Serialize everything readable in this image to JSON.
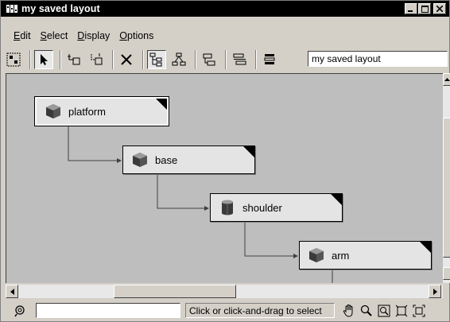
{
  "window": {
    "title": "my saved layout"
  },
  "menubar": {
    "items": [
      {
        "label": "Edit",
        "mnemonic": "E",
        "rest": "dit"
      },
      {
        "label": "Select",
        "mnemonic": "S",
        "rest": "elect"
      },
      {
        "label": "Display",
        "mnemonic": "D",
        "rest": "isplay"
      },
      {
        "label": "Options",
        "mnemonic": "O",
        "rest": "ptions"
      }
    ]
  },
  "toolbar": {
    "layout_name": "my saved layout",
    "icons": [
      "layout-icon",
      "select-arrow-icon",
      "parent-icon",
      "unparent-icon",
      "delete-icon",
      "hierarchy-icon",
      "tree-icon",
      "graph-icon",
      "align-icon",
      "list-icon"
    ]
  },
  "nodes": [
    {
      "label": "platform",
      "icon": "cube-icon"
    },
    {
      "label": "base",
      "icon": "cube-icon"
    },
    {
      "label": "shoulder",
      "icon": "cylinder-icon"
    },
    {
      "label": "arm",
      "icon": "cube-icon"
    }
  ],
  "statusbar": {
    "input_value": "",
    "message": "Click or click-and-drag to select",
    "icons": [
      "pan-hand-icon",
      "zoom-icon",
      "zoom-region-icon",
      "frame-all-icon",
      "frame-selected-icon"
    ]
  },
  "colors": {
    "titlebar": "#000000",
    "canvas": "#bebebe",
    "node": "#e4e4e4",
    "chrome": "#d4d0c8"
  }
}
